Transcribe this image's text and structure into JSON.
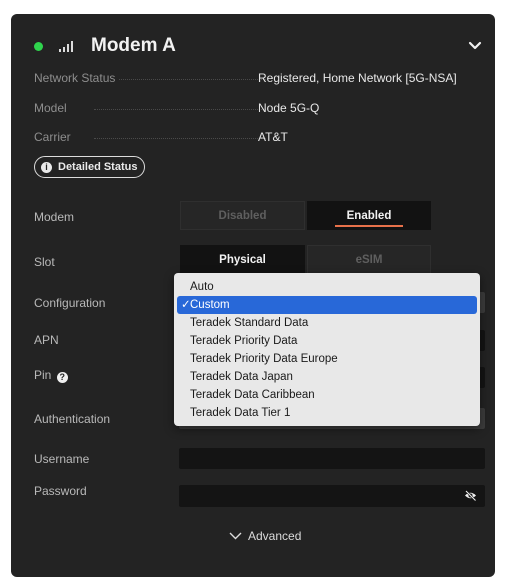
{
  "modem": {
    "title": "Modem A",
    "status_color": "#2fd44d"
  },
  "info": [
    {
      "label": "Network Status",
      "value": "Registered, Home Network [5G-NSA]"
    },
    {
      "label": "Model",
      "value": "Node 5G-Q"
    },
    {
      "label": "Carrier",
      "value": "AT&T"
    }
  ],
  "detailed_status_label": "Detailed Status",
  "form": {
    "modem_label": "Modem",
    "modem_options": [
      "Disabled",
      "Enabled"
    ],
    "modem_selected": "Enabled",
    "slot_label": "Slot",
    "slot_options": [
      "Physical",
      "eSIM"
    ],
    "slot_selected": "Physical",
    "configuration_label": "Configuration",
    "apn_label": "APN",
    "pin_label": "Pin",
    "authentication_label": "Authentication",
    "username_label": "Username",
    "password_label": "Password"
  },
  "configuration_dropdown": {
    "options": [
      "Auto",
      "Custom",
      "Teradek Standard Data",
      "Teradek Priority Data",
      "Teradek Priority Data Europe",
      "Teradek Data Japan",
      "Teradek Data Caribbean",
      "Teradek Data Tier 1"
    ],
    "selected": "Custom",
    "highlight_color": "#2868d8"
  },
  "advanced_label": "Advanced",
  "accent_color": "#e8714a",
  "icons": {
    "status": "status-dot",
    "signal": "signal-bars-icon",
    "collapse": "chevron-down-icon",
    "info": "info-icon",
    "help": "help-icon",
    "password_visibility": "eye-slash-icon",
    "advanced": "chevron-down-icon",
    "selected": "checkmark-icon"
  }
}
